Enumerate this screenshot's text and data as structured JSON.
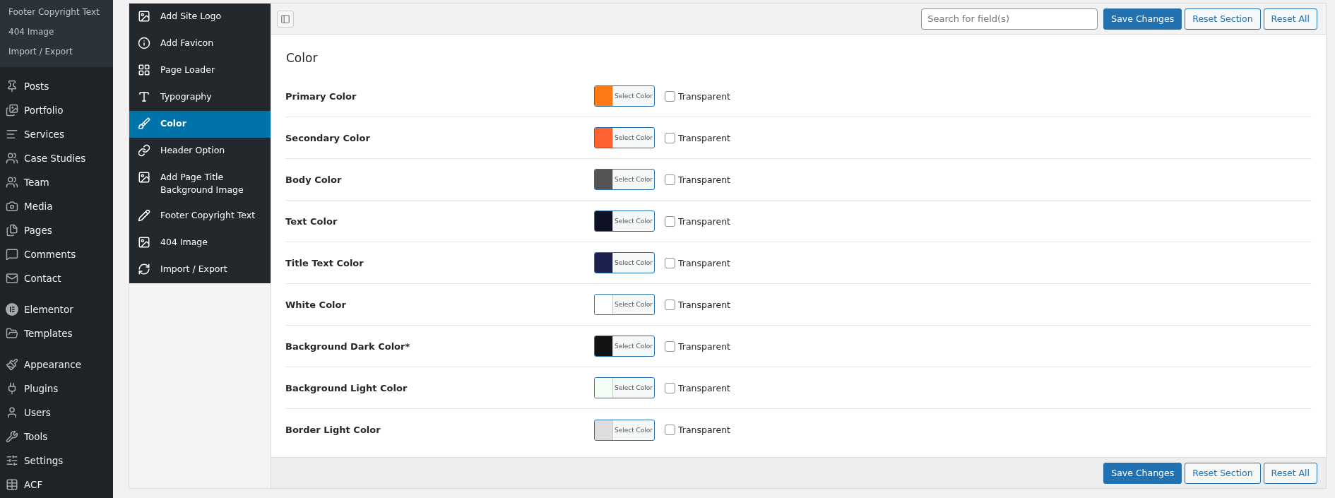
{
  "admin_menu": {
    "submenu": [
      "Footer Copyright Text",
      "404 Image",
      "Import / Export"
    ],
    "groups": [
      [
        "Posts",
        "Portfolio",
        "Services",
        "Case Studies",
        "Team",
        "Media",
        "Pages",
        "Comments",
        "Contact"
      ],
      [
        "Elementor",
        "Templates"
      ],
      [
        "Appearance",
        "Plugins",
        "Users",
        "Tools",
        "Settings",
        "ACF"
      ]
    ]
  },
  "options_sidebar": [
    {
      "label": "Add Site Logo",
      "selected": false
    },
    {
      "label": "Add Favicon",
      "selected": false
    },
    {
      "label": "Page Loader",
      "selected": false
    },
    {
      "label": "Typography",
      "selected": false
    },
    {
      "label": "Color",
      "selected": true
    },
    {
      "label": "Header Option",
      "selected": false
    },
    {
      "label": "Add Page Title Background Image",
      "selected": false
    },
    {
      "label": "Footer Copyright Text",
      "selected": false
    },
    {
      "label": "404 Image",
      "selected": false
    },
    {
      "label": "Import / Export",
      "selected": false
    }
  ],
  "toolbar": {
    "search": {
      "placeholder": "Search for field(s)"
    },
    "buttons": [
      "Save Changes",
      "Reset Section",
      "Reset All"
    ]
  },
  "section_title": "Color",
  "fields": [
    {
      "label": "Primary Color",
      "color": "#ff7a14",
      "button": "Select Color",
      "transparent_label": "Transparent",
      "checked": false
    },
    {
      "label": "Secondary Color",
      "color": "#ff6130",
      "button": "Select Color",
      "transparent_label": "Transparent",
      "checked": false
    },
    {
      "label": "Body Color",
      "color": "#555354",
      "button": "Select Color",
      "transparent_label": "Transparent",
      "checked": false
    },
    {
      "label": "Text Color",
      "color": "#0e1024",
      "button": "Select Color",
      "transparent_label": "Transparent",
      "checked": false
    },
    {
      "label": "Title Text Color",
      "color": "#1d2150",
      "button": "Select Color",
      "transparent_label": "Transparent",
      "checked": false
    },
    {
      "label": "White Color",
      "color": "#ffffff",
      "button": "Select Color",
      "transparent_label": "Transparent",
      "checked": false
    },
    {
      "label": "Background Dark Color*",
      "color": "#121212",
      "button": "Select Color",
      "transparent_label": "Transparent",
      "checked": false
    },
    {
      "label": "Background Light Color",
      "color": "#f3fff5",
      "button": "Select Color",
      "transparent_label": "Transparent",
      "checked": false
    },
    {
      "label": "Border Light Color",
      "color": "#dedcdd",
      "button": "Select Color",
      "transparent_label": "Transparent",
      "checked": false
    }
  ],
  "footer_buttons": [
    "Save Changes",
    "Reset Section",
    "Reset All"
  ]
}
